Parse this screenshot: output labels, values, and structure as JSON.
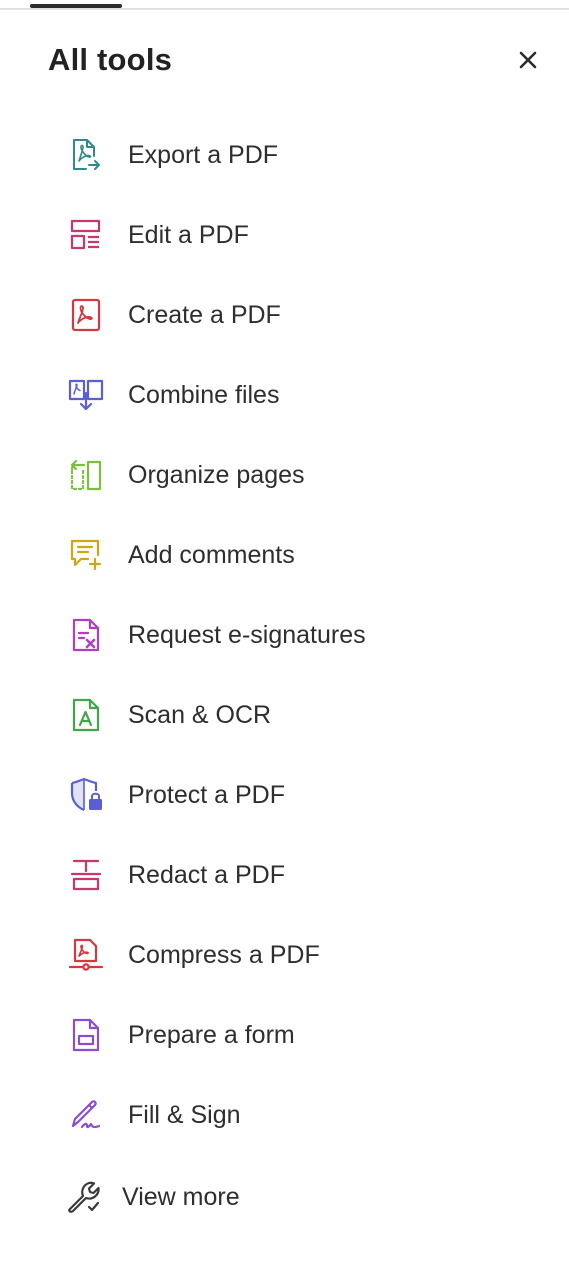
{
  "panel": {
    "title": "All tools",
    "close_icon": "close-icon"
  },
  "tools": [
    {
      "label": "Export a PDF",
      "icon": "export-pdf-icon",
      "color": "#2f8a8f"
    },
    {
      "label": "Edit a PDF",
      "icon": "edit-pdf-icon",
      "color": "#c8376e"
    },
    {
      "label": "Create a PDF",
      "icon": "create-pdf-icon",
      "color": "#d7373f"
    },
    {
      "label": "Combine files",
      "icon": "combine-files-icon",
      "color": "#5b5fd6"
    },
    {
      "label": "Organize pages",
      "icon": "organize-pages-icon",
      "color": "#7cbf3f"
    },
    {
      "label": "Add comments",
      "icon": "add-comments-icon",
      "color": "#d1a516"
    },
    {
      "label": "Request e-signatures",
      "icon": "request-esignatures-icon",
      "color": "#b23dbf"
    },
    {
      "label": "Scan & OCR",
      "icon": "scan-ocr-icon",
      "color": "#3fa64a"
    },
    {
      "label": "Protect a PDF",
      "icon": "protect-pdf-icon",
      "color": "#5b5fd6"
    },
    {
      "label": "Redact a PDF",
      "icon": "redact-pdf-icon",
      "color": "#c8376e"
    },
    {
      "label": "Compress a PDF",
      "icon": "compress-pdf-icon",
      "color": "#d7373f"
    },
    {
      "label": "Prepare a form",
      "icon": "prepare-form-icon",
      "color": "#8a4fd0"
    },
    {
      "label": "Fill & Sign",
      "icon": "fill-sign-icon",
      "color": "#8a4fd0"
    }
  ],
  "view_more": {
    "label": "View more",
    "icon": "wrench-icon",
    "color": "#3a3a3a"
  }
}
